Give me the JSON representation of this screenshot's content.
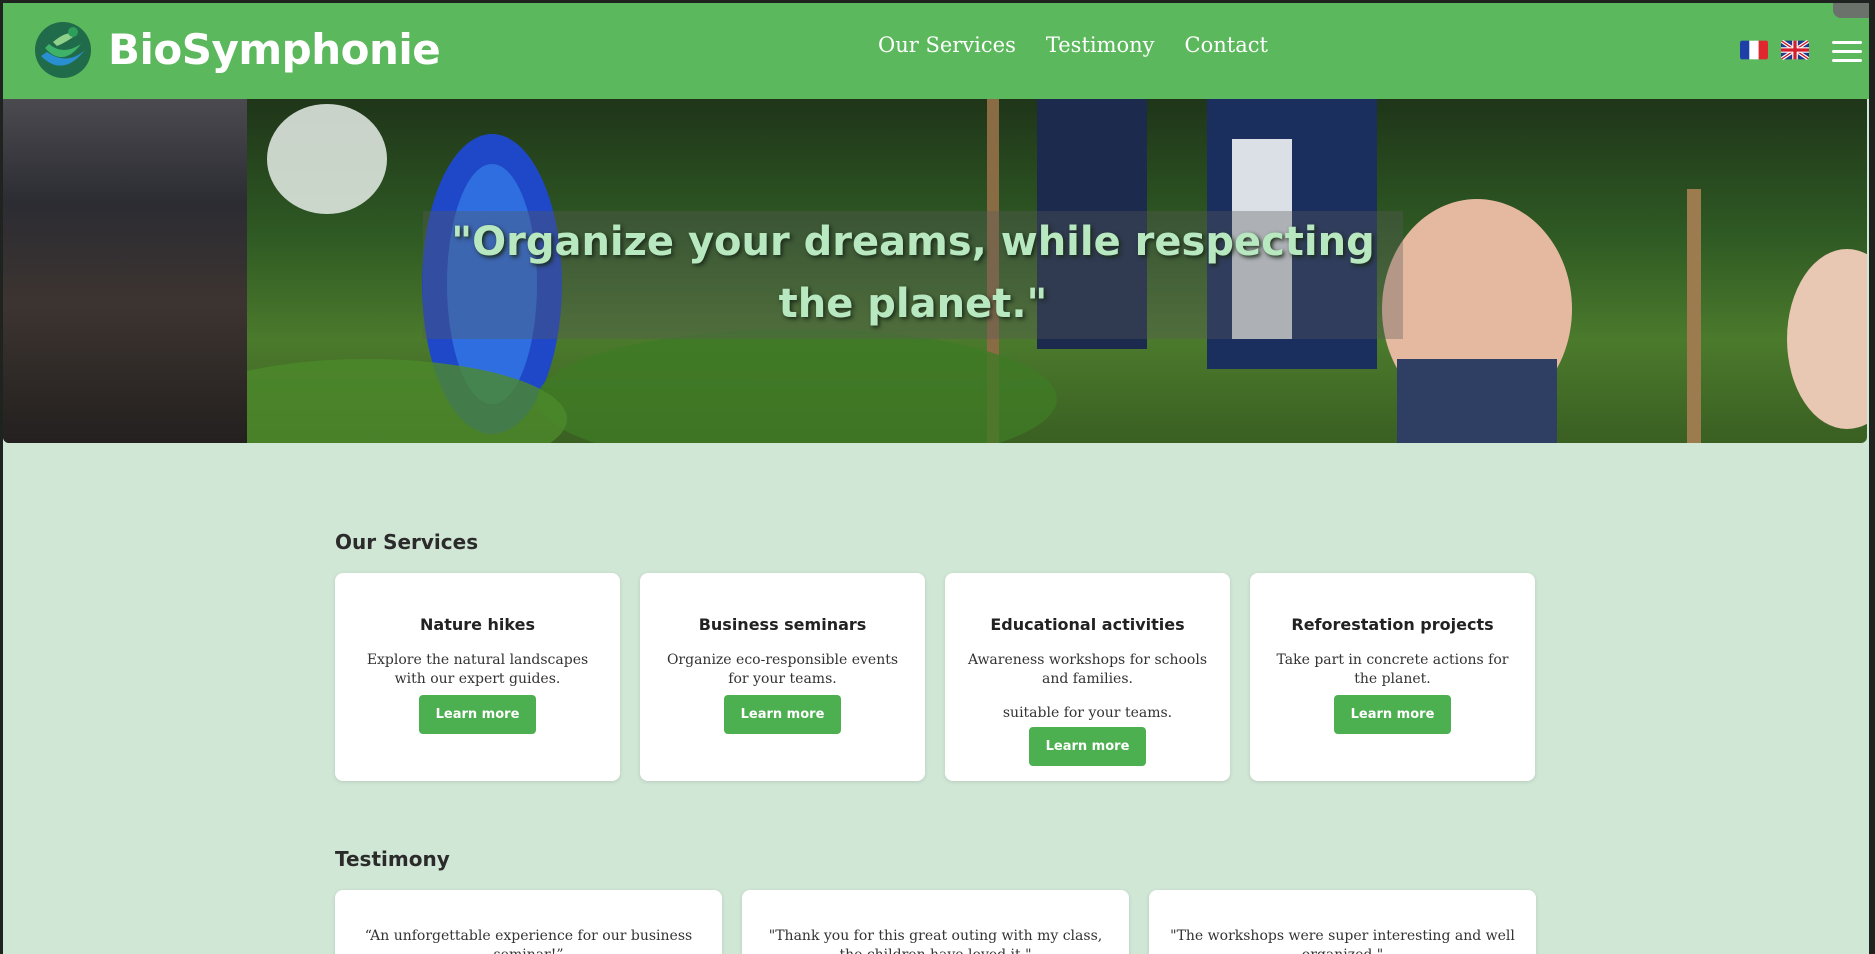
{
  "header": {
    "brand": "BioSymphonie",
    "nav": [
      "Our Services",
      "Testimony",
      "Contact"
    ]
  },
  "hero": {
    "quote": "\"Organize your dreams, while respecting the planet.\""
  },
  "services": {
    "title": "Our Services",
    "cards": [
      {
        "title": "Nature hikes",
        "desc": "Explore the natural landscapes with our expert guides.",
        "button": "Learn more"
      },
      {
        "title": "Business seminars",
        "desc": "Organize eco-responsible events for your teams.",
        "button": "Learn more"
      },
      {
        "title": "Educational activities",
        "desc": "Awareness workshops for schools and families.",
        "extra": "suitable for your teams.",
        "button": "Learn more"
      },
      {
        "title": "Reforestation projects",
        "desc": "Take part in concrete actions for the planet.",
        "button": "Learn more"
      }
    ]
  },
  "testimony": {
    "title": "Testimony",
    "quotes": [
      "“An unforgettable experience for our business seminar!”",
      "\"Thank you for this great outing with my class, the children have loved it.\"",
      "\"The workshops were super interesting and well organized.\""
    ]
  },
  "colors": {
    "header_bg": "#5cb85c",
    "page_bg": "#d1e7d6",
    "button_bg": "#4caf50"
  },
  "icons": [
    "logo-icon",
    "flag-fr-icon",
    "flag-uk-icon",
    "hamburger-menu-icon"
  ]
}
